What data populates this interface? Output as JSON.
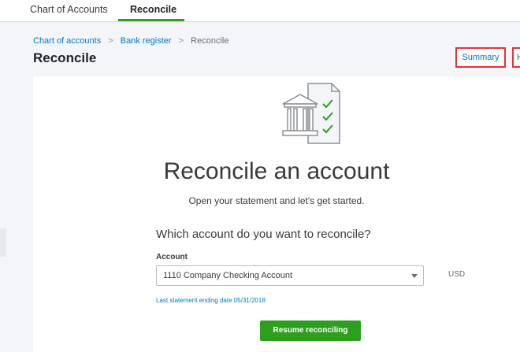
{
  "tabs": {
    "chart_of_accounts": "Chart of Accounts",
    "reconcile": "Reconcile"
  },
  "breadcrumb": {
    "chart_of_accounts": "Chart of accounts",
    "separator": ">",
    "bank_register": "Bank register",
    "current": "Reconcile"
  },
  "page": {
    "title": "Reconcile",
    "summary_label": "Summary",
    "history_label": "H"
  },
  "card": {
    "illustration_icon": "bank-statement-check-icon",
    "heading": "Reconcile an account",
    "subheading": "Open your statement and let's get started.",
    "question": "Which account do you want to reconcile?",
    "account_label": "Account",
    "account_value": "1110 Company Checking Account",
    "currency": "USD",
    "last_statement": "Last statement ending date 05/31/2018",
    "resume_label": "Resume reconciling"
  },
  "colors": {
    "accent_green": "#2ca01c",
    "link_blue": "#0077c5",
    "highlight_red": "#e03535"
  }
}
